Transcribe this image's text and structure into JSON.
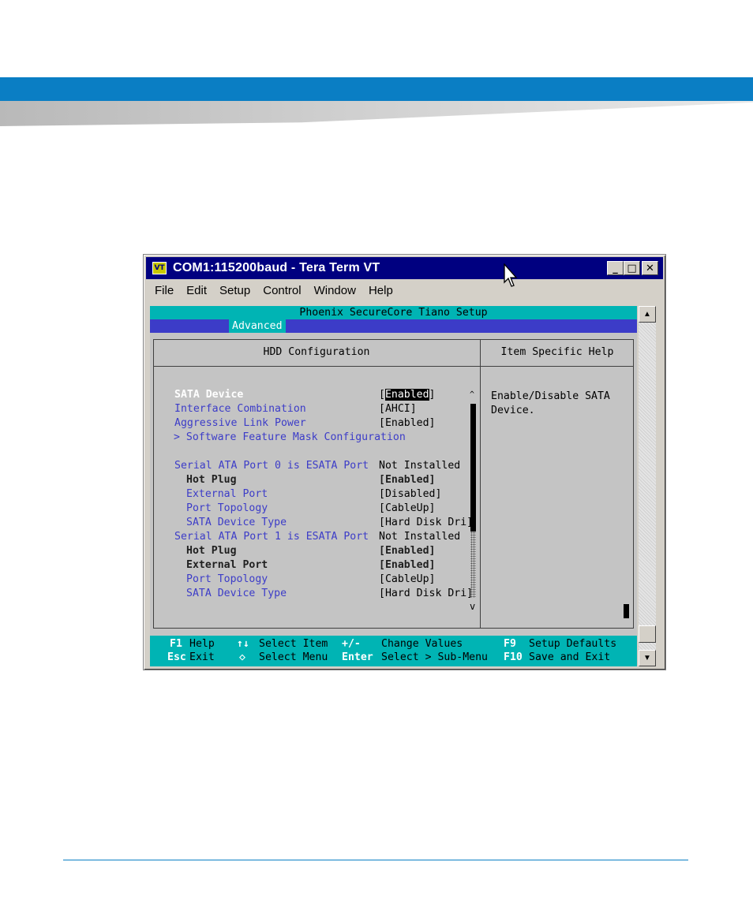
{
  "window": {
    "title": "COM1:115200baud - Tera Term VT",
    "app_icon_label": "VT",
    "buttons": {
      "minimize": "_",
      "maximize": "□",
      "close": "✕"
    }
  },
  "menu": [
    "File",
    "Edit",
    "Setup",
    "Control",
    "Window",
    "Help"
  ],
  "bios": {
    "title": "Phoenix SecureCore Tiano Setup",
    "active_tab": "Advanced",
    "section_title": "HDD Configuration",
    "help_title": "Item Specific Help",
    "help_text": "Enable/Disable SATA\nDevice.",
    "items": [
      {
        "label": "SATA Device",
        "value": "[",
        "value_hl": "Enabled",
        "value_end": "]"
      },
      {
        "label": "Interface Combination",
        "value": "[AHCI]"
      },
      {
        "label": "Aggressive Link Power",
        "value": "[Enabled]"
      },
      {
        "label": "> Software Feature Mask Configuration"
      },
      {
        "label": "Serial ATA Port 0 is ESATA Port",
        "value": "Not Installed"
      },
      {
        "label": "Hot Plug",
        "value": "[Enabled]"
      },
      {
        "label": "External Port",
        "value": "[Disabled]"
      },
      {
        "label": "Port Topology",
        "value": "[CableUp]"
      },
      {
        "label": "SATA Device Type",
        "value": "[Hard Disk Dri]"
      },
      {
        "label": "Serial ATA Port 1 is ESATA Port",
        "value": "Not Installed"
      },
      {
        "label": "Hot Plug",
        "value": "[Enabled]"
      },
      {
        "label": "External Port",
        "value": "[Enabled]"
      },
      {
        "label": "Port Topology",
        "value": "[CableUp]"
      },
      {
        "label": "SATA Device Type",
        "value": "[Hard Disk Dri]"
      }
    ],
    "scroll_up": "^",
    "scroll_down": "v",
    "keys": {
      "f1": "F1",
      "help": "Help",
      "esc": "Esc",
      "exit": "Exit",
      "updown": "↑↓",
      "select_item": "Select Item",
      "leftright": "◇",
      "select_menu": "Select Menu",
      "plusminus": "+/-",
      "change_values": "Change Values",
      "enter": "Enter",
      "select_submenu": "Select > Sub-Menu",
      "f9": "F9",
      "setup_defaults": "Setup Defaults",
      "f10": "F10",
      "save_exit": "Save and Exit"
    }
  }
}
